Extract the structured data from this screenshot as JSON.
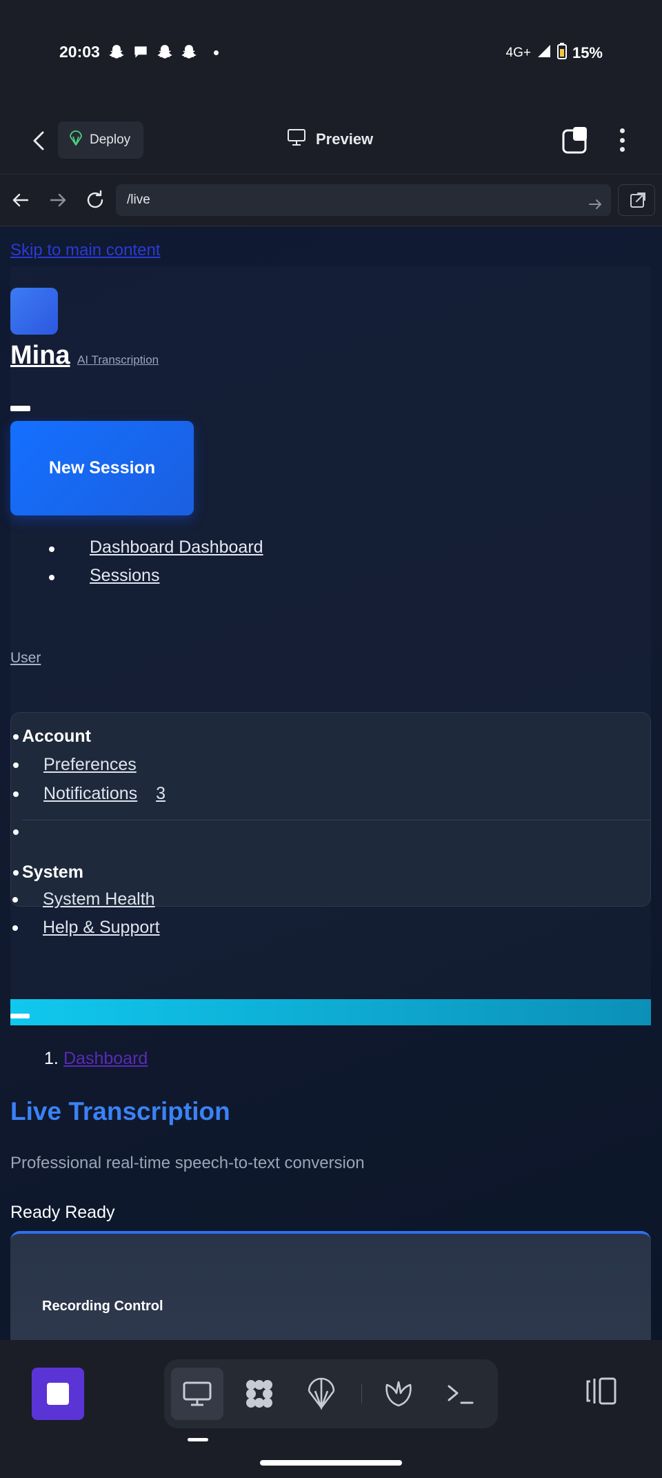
{
  "status_bar": {
    "time": "20:03",
    "network": "4G+",
    "battery": "15%",
    "notification_icons": [
      "snapchat-icon",
      "chat-icon",
      "snapchat-icon",
      "snapchat-icon"
    ]
  },
  "toolbar": {
    "deploy_label": "Deploy",
    "preview_label": "Preview"
  },
  "url_bar": {
    "url": "/live"
  },
  "page": {
    "skip_link": "Skip to main content",
    "brand": {
      "name": "Mina",
      "tagline": "AI Transcription"
    },
    "new_session_label": "New Session",
    "nav_items": [
      "Dashboard Dashboard",
      "Sessions"
    ],
    "user_link": "User",
    "menu": {
      "account_heading": "Account",
      "preferences": "Preferences",
      "notifications": "Notifications",
      "notifications_count": "3",
      "system_heading": "System",
      "system_health": "System Health",
      "help_support": "Help & Support"
    },
    "breadcrumb": {
      "number": "1.",
      "label": "Dashboard"
    },
    "title": "Live Transcription",
    "subtitle": "Professional real-time speech-to-text conversion",
    "status_text": "Ready Ready",
    "card_title": "Recording Control"
  },
  "colors": {
    "accent_blue": "#3b82f6",
    "button_blue": "#1470ff",
    "cyan": "#10c8ee",
    "stop_purple": "#5b34d6"
  }
}
